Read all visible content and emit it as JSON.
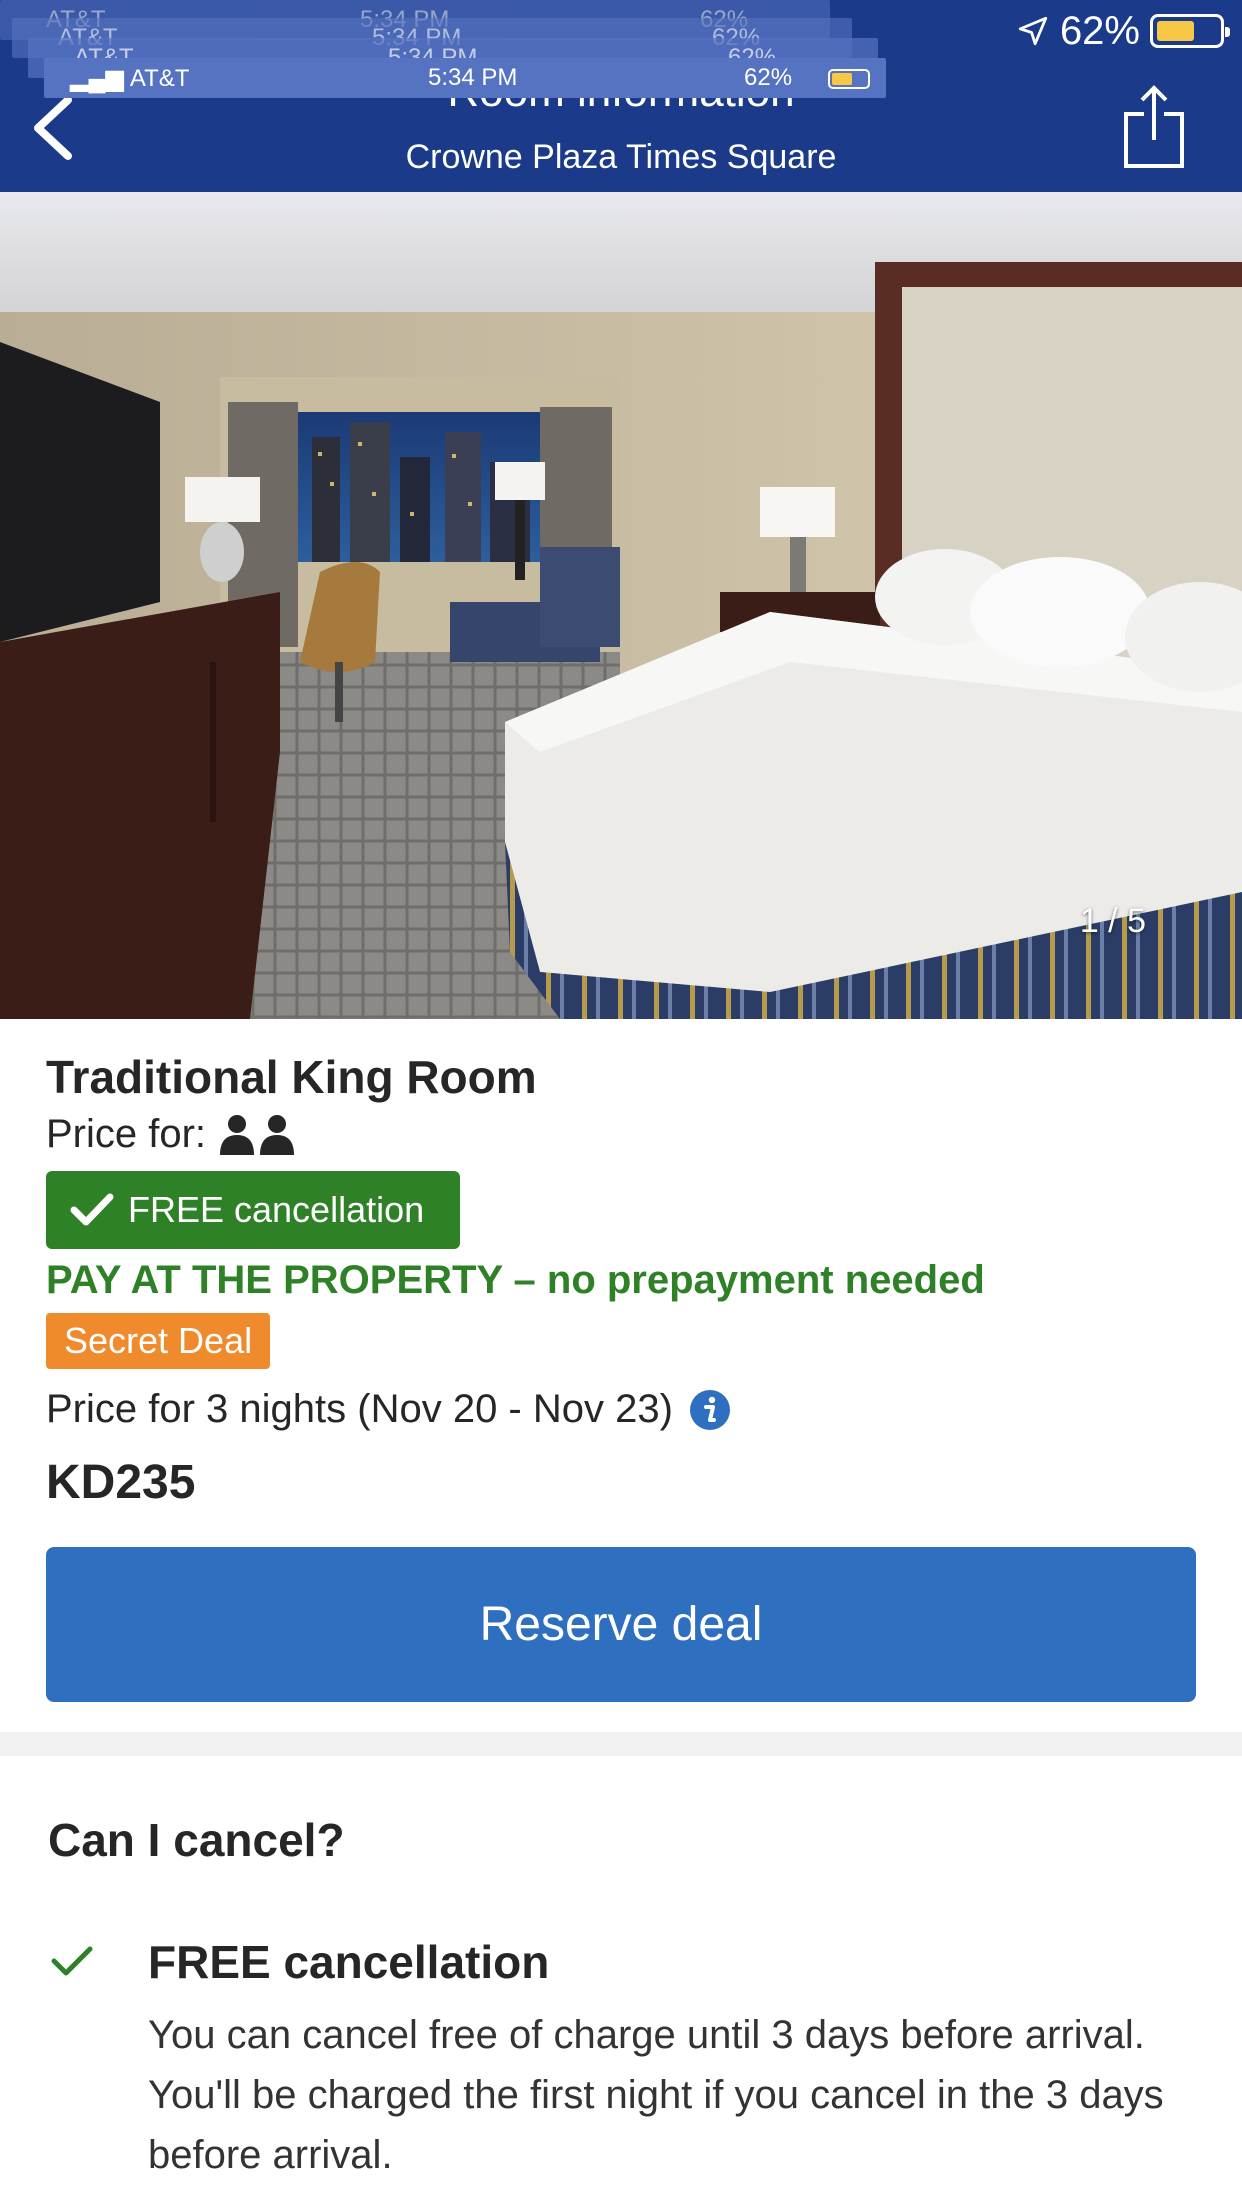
{
  "status_bar": {
    "carrier": "AT&T",
    "time": "5:34 PM",
    "battery_percent": "62%",
    "battery_level": 0.62,
    "battery_color": "#f7c845"
  },
  "header": {
    "title": "Room information",
    "subtitle": "Crowne Plaza Times Square",
    "background_color": "#1b3a8a",
    "back_icon": "chevron-left-icon",
    "share_icon": "share-icon"
  },
  "photo": {
    "counter": "1 / 5"
  },
  "room": {
    "name": "Traditional King Room",
    "price_for_label": "Price for:",
    "occupancy_icon": "two-people-icon",
    "free_cancellation_badge": "FREE cancellation",
    "pay_at_property": "PAY AT THE PROPERTY – no prepayment needed",
    "secret_deal_badge": "Secret Deal",
    "nights_text": "Price for 3 nights (Nov 20 - Nov 23)",
    "price": "KD235",
    "reserve_button": "Reserve deal"
  },
  "colors": {
    "green": "#2f8128",
    "orange": "#ef8b2c",
    "blue": "#2e6fc0"
  },
  "cancel_section": {
    "title": "Can I cancel?",
    "item_title": "FREE cancellation",
    "item_text": "You can cancel free of charge until 3 days before arrival. You'll be charged the first night if you cancel in the 3 days before arrival."
  }
}
